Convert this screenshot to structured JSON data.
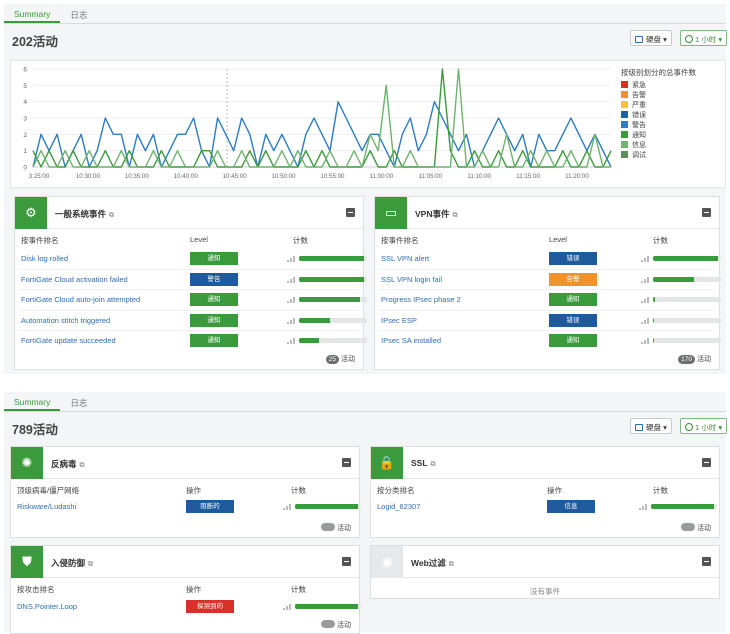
{
  "top": {
    "tabs": [
      "Summary",
      "日志"
    ],
    "title": "202活动",
    "disk_label": "硬盘",
    "time_label": "1 小时",
    "chart_data": {
      "type": "line",
      "title": "按级别划分的总事件数",
      "ylim": [
        0,
        6
      ],
      "yticks": [
        "0",
        "1",
        "2",
        "3",
        "4",
        "5",
        "6"
      ],
      "xticks": [
        "3:25:00",
        "10:30:00",
        "10:35:00",
        "10:40:00",
        "10:45:00",
        "10:50:00",
        "10:55:00",
        "11:00:00",
        "11:05:00",
        "11:10:00",
        "11:15:00",
        "11:20:00"
      ],
      "series": [
        {
          "name": "紧急",
          "color": "#d8312a",
          "values": []
        },
        {
          "name": "告警",
          "color": "#f0932b",
          "values": []
        },
        {
          "name": "严重",
          "color": "#f6c344",
          "values": []
        },
        {
          "name": "错误",
          "color": "#1f5fa6",
          "values": []
        },
        {
          "name": "警告",
          "color": "#2d7bc4",
          "values": [
            0,
            2,
            1,
            2,
            0,
            1,
            2,
            0,
            1,
            3,
            2,
            2,
            0,
            2,
            1,
            2,
            0,
            1,
            2,
            2,
            3,
            1,
            0,
            3,
            2,
            1,
            3,
            2,
            0,
            2,
            1,
            2,
            1,
            0,
            2,
            3,
            2,
            1,
            4,
            3,
            2,
            1,
            2,
            2,
            1,
            0,
            2,
            3,
            1,
            2,
            4,
            3,
            2,
            1,
            2,
            0,
            1,
            2,
            3,
            2,
            1,
            2,
            0,
            2,
            1,
            1,
            2,
            3,
            2,
            1,
            2,
            1,
            0
          ]
        },
        {
          "name": "通知",
          "color": "#3b9a3b",
          "values": [
            1,
            0,
            1,
            0,
            0,
            1,
            0,
            0,
            0,
            1,
            0,
            0,
            1,
            0,
            0,
            0,
            1,
            0,
            0,
            0,
            0,
            1,
            1,
            0,
            0,
            0,
            0,
            1,
            0,
            1,
            0,
            0,
            0,
            0,
            1,
            0,
            1,
            0,
            0,
            0,
            0,
            0,
            1,
            0,
            0,
            1,
            0,
            0,
            0,
            0,
            0,
            6,
            1,
            0,
            0,
            1,
            0,
            0,
            1,
            0,
            0,
            1,
            0,
            0,
            0,
            0,
            1,
            0,
            0,
            1,
            0,
            0,
            1
          ]
        },
        {
          "name": "信息",
          "color": "#6fb26f",
          "values": [
            0,
            1,
            0,
            0,
            1,
            0,
            0,
            1,
            0,
            0,
            0,
            1,
            0,
            0,
            0,
            1,
            0,
            0,
            1,
            0,
            0,
            0,
            0,
            1,
            0,
            0,
            1,
            0,
            0,
            0,
            0,
            1,
            0,
            1,
            0,
            0,
            0,
            1,
            0,
            0,
            1,
            0,
            2,
            1,
            5,
            0,
            0,
            1,
            0,
            0,
            0,
            0,
            0,
            6,
            0,
            0,
            1,
            0,
            0,
            2,
            0,
            0,
            1,
            0,
            1,
            0,
            0,
            1,
            0,
            0,
            2,
            0,
            0
          ]
        },
        {
          "name": "调试",
          "color": "#5a8f5a",
          "values": []
        }
      ]
    },
    "widgets": [
      {
        "title": "一般系统事件",
        "col1": "按事件排名",
        "col2": "Level",
        "col3": "计数",
        "rows": [
          {
            "name": "Disk log rolled",
            "level": "通知",
            "level_color": "green",
            "bar": 0.95
          },
          {
            "name": "FortiGate Cloud activation failed",
            "level": "警告",
            "level_color": "blue",
            "bar": 0.95
          },
          {
            "name": "FortiGate Cloud auto-join attempted",
            "level": "通知",
            "level_color": "green",
            "bar": 0.9
          },
          {
            "name": "Automation stitch triggered",
            "level": "通知",
            "level_color": "green",
            "bar": 0.45
          },
          {
            "name": "FortiGate update succeeded",
            "level": "通知",
            "level_color": "green",
            "bar": 0.3
          }
        ],
        "count": "25",
        "count_suffix": "活动"
      },
      {
        "title": "VPN事件",
        "col1": "按事件排名",
        "col2": "Level",
        "col3": "计数",
        "rows": [
          {
            "name": "SSL VPN alert",
            "level": "错误",
            "level_color": "blue",
            "bar": 0.95
          },
          {
            "name": "SSL VPN login fail",
            "level": "告警",
            "level_color": "orange",
            "bar": 0.6
          },
          {
            "name": "Progress IPsec phase 2",
            "level": "通知",
            "level_color": "green",
            "bar": 0.03
          },
          {
            "name": "IPsec ESP",
            "level": "错误",
            "level_color": "blue",
            "bar": 0.02
          },
          {
            "name": "IPsec SA installed",
            "level": "通知",
            "level_color": "green",
            "bar": 0.02
          }
        ],
        "count": "170",
        "count_suffix": "活动"
      }
    ]
  },
  "bottom": {
    "tabs": [
      "Summary",
      "日志"
    ],
    "title": "789活动",
    "disk_label": "硬盘",
    "time_label": "1 小时",
    "widgets": [
      {
        "title": "反病毒",
        "col1": "顶级病毒/僵尸网络",
        "col2": "操作",
        "col3": "计数",
        "rows": [
          {
            "name": "Riskware/Ludashi",
            "level": "阻断的",
            "level_color": "blue",
            "bar": 0.95
          }
        ],
        "count_suffix": "活动"
      },
      {
        "title": "SSL",
        "col1": "按分类排名",
        "col2": "操作",
        "col3": "计数",
        "rows": [
          {
            "name": "Logid_62307",
            "level": "信息",
            "level_color": "blue",
            "bar": 0.95
          }
        ],
        "count_suffix": "活动"
      },
      {
        "title": "入侵防御",
        "col1": "按攻击排名",
        "col2": "操作",
        "col3": "计数",
        "rows": [
          {
            "name": "DNS.Pointer.Loop",
            "level": "探测到的",
            "level_color": "red",
            "bar": 0.95
          }
        ],
        "count_suffix": "活动"
      },
      {
        "title": "Web过滤",
        "empty_text": "没有事件"
      }
    ]
  }
}
